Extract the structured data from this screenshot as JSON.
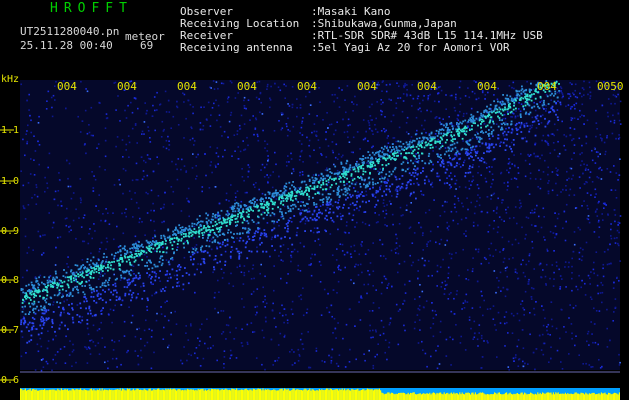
{
  "header": {
    "app_title": "HROFFT",
    "filename": "UT2511280040.pn",
    "suffix_label": "meteor",
    "datetime": "25.11.28 00:40",
    "count": "69"
  },
  "info": [
    {
      "key": "Observer",
      "value": ":Masaki Kano"
    },
    {
      "key": "Receiving Location",
      "value": ":Shibukawa,Gunma,Japan"
    },
    {
      "key": "Receiver",
      "value": ":RTL-SDR SDR# 43dB L15 114.1MHz USB"
    },
    {
      "key": "Receiving antenna",
      "value": ":5el Yagi Az 20 for Aomori VOR"
    }
  ],
  "axis": {
    "freq_unit": "kHz",
    "freq_ticks": [
      "1.1",
      "1.0",
      "0.9",
      "0.8",
      "0.7",
      "0.6"
    ],
    "time_ticks": [
      "004",
      "004",
      "004",
      "004",
      "004",
      "004",
      "004",
      "004",
      "004",
      "0050"
    ]
  },
  "colors": {
    "background": "#000000",
    "noise_blue": "#1a2ad8",
    "signal_cyan": "#30e0d0",
    "axis_yellow": "#e6e600",
    "level_bar_yellow": "#ffff00",
    "app_title_green": "#00d000"
  }
}
